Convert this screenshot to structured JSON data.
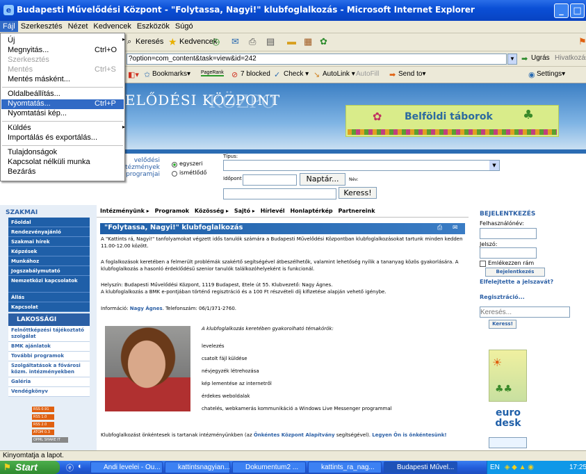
{
  "window": {
    "title": "Budapesti Művelődési Központ - \"Folytassa, Nagyi!\" klubfoglalkozás - Microsoft Internet Explorer"
  },
  "menubar": [
    "Fájl",
    "Szerkesztés",
    "Nézet",
    "Kedvencek",
    "Eszközök",
    "Súgó"
  ],
  "toolbar": {
    "search": "Keresés",
    "favorites": "Kedvencek"
  },
  "address": {
    "url": "?option=com_content&task=view&id=242",
    "go": "Ugrás",
    "links": "Hivatkozások"
  },
  "linkbar": {
    "bookmarks": "Bookmarks▾",
    "pagerank": "PageRank",
    "blocked": "7 blocked",
    "check": "Check ▾",
    "autolink": "AutoLink ▾",
    "autofill": "AutoFill",
    "sendto": "Send to▾",
    "settings": "Settings▾"
  },
  "filemenu": {
    "new": "Új",
    "open": "Megnyitás...",
    "open_sc": "Ctrl+O",
    "edit": "Szerkesztés",
    "save": "Mentés",
    "save_sc": "Ctrl+S",
    "saveas": "Mentés másként...",
    "pagesetup": "Oldalbeállítás...",
    "print": "Nyomtatás...",
    "print_sc": "Ctrl+P",
    "preview": "Nyomtatási kép...",
    "send": "Küldés",
    "import": "Importálás és exportálás...",
    "props": "Tulajdonságok",
    "offline": "Kapcsolat nélküli munka",
    "close": "Bezárás"
  },
  "banner": {
    "logo": "ELŐDÉSI KÖZPONT",
    "ghost": "KÖZPO",
    "camp": "Belföldi táborok"
  },
  "searchband": {
    "left1": "velődési",
    "left2": "tézmények",
    "left3": "programjai",
    "once": "egyszeri",
    "repeat": "ismétlődő",
    "tipus": "Típus:",
    "idopont": "Időpont",
    "calendar": "Naptár...",
    "nev": "Név:",
    "search_btn": "Keress!"
  },
  "left": {
    "szakmai": "SZAKMAI",
    "items": [
      "Főoldal",
      "Rendezvényajánló",
      "Szakmai hírek",
      "Képzések",
      "Munkához",
      "Jogszabálymutató",
      "Nemzetközi kapcsolatok",
      "Állás",
      "Kapcsolat"
    ],
    "lakossagi": "LAKOSSÁGI",
    "lak_items": [
      "Felnőttképzési tájékoztató szolgálat",
      "BMK ajánlatok",
      "További programok",
      "Szolgáltatások a fővárosi közm. intézményekben",
      "Galéria",
      "Vendégkönyv"
    ],
    "rss": [
      "RSS 0.91",
      "RSS 1.0",
      "RSS 2.0",
      "ATOM 0.3",
      "OPML SHARE IT"
    ]
  },
  "nav": [
    "Intézményünk ▸",
    "Programok",
    "Közösség ▸",
    "Sajtó ▸",
    "Hírlevél",
    "Honlaptérkép",
    "Partnereink"
  ],
  "article": {
    "title": "\"Folytassa, Nagyi!\" klubfoglalkozás",
    "p1": "A \"Kattints rá, Nagyi!\" tanfolyamokat végzett idős tanulók számára a Budapesti Művelődési Központban klubfoglalkozásokat tartunk minden kedden 11.00-12.00 között.",
    "p2": "A foglalkozások keretében a felmerült problémák szakértő segítségével átbeszélhetők, valamint lehetőség nyílik a tananyag közös gyakorlására. A klubfoglalkozás a hasonló érdeklődésű szenior tanulók találkozóhelyeként is funkcionál.",
    "p3a": "Helyszín: Budapesti Művelődési Központ, 1119 Budapest, Etele út 55. Klubvezető: Nagy Ágnes.",
    "p3b": "A klubfoglalkozás a BMK e-pontjában történő regisztráció és a 100 Ft részvételi díj kifizetése alapján vehető igénybe.",
    "info": "Információ:",
    "info_name": "Nagy Ágnes",
    "info_tel": ". Telefonszám: 06/1/371-2760.",
    "topics_title": "A klubfoglalkozás keretében gyakorolható témakörök:",
    "topics": [
      "levelezés",
      "csatolt fájl küldése",
      "névjegyzék létrehozása",
      "kép lementése az internetről",
      "érdekes weboldalak",
      "chatelés, webkamerás kommunikáció a Windows Live Messenger programmal"
    ],
    "footer1": "Klubfoglalkozást önkéntesek is tartanak intézményünkben (az",
    "footer2": "Önkéntes Központ Alapítvány",
    "footer3": "segítségével).",
    "footer4": "Legyen Ön is önkéntesünk!"
  },
  "right": {
    "login": "BEJELENTKEZÉS",
    "user": "Felhasználónév:",
    "pass": "Jelszó:",
    "remember": "Emlékezzen rám",
    "login_btn": "Bejelentkezés",
    "forgot": "Elfelejtette a jelszavát?",
    "register": "Regisztráció...",
    "search_ph": "Keresés...",
    "search_btn": "Keress!",
    "euro": "euro",
    "desk": "desk"
  },
  "status": {
    "text": "Kinyomtatja a lapot."
  },
  "taskbar": {
    "start": "Start",
    "tasks": [
      "Andi levelei - Ou...",
      "kattintsnagyian...",
      "Dokumentum2 ...",
      "kattints_ra_nag...",
      "Budapesti Művel..."
    ],
    "lang": "EN",
    "clock": "17:25"
  }
}
